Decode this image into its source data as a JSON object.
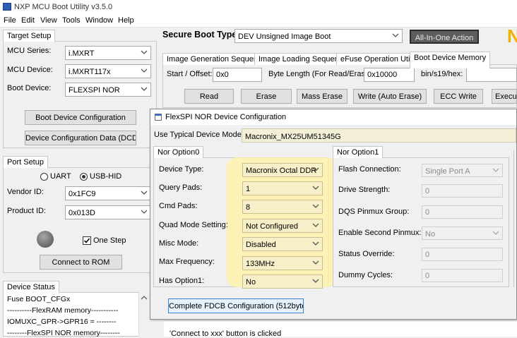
{
  "window": {
    "title": "NXP MCU Boot Utility v3.5.0"
  },
  "menu": [
    "File",
    "Edit",
    "View",
    "Tools",
    "Window",
    "Help"
  ],
  "target_setup": {
    "tab": "Target Setup",
    "mcu_series_label": "MCU Series:",
    "mcu_series": "i.MXRT",
    "mcu_device_label": "MCU Device:",
    "mcu_device": "i.MXRT117x",
    "boot_device_label": "Boot Device:",
    "boot_device": "FLEXSPI NOR",
    "boot_device_config_button": "Boot Device Configuration",
    "dcd_button": "Device Configuration Data (DCD)"
  },
  "port_setup": {
    "tab": "Port Setup",
    "uart_label": "UART",
    "usbhid_label": "USB-HID",
    "vendor_id_label": "Vendor ID:",
    "vendor_id": "0x1FC9",
    "product_id_label": "Product ID:",
    "product_id": "0x013D",
    "one_step_label": "One Step",
    "connect_button": "Connect to ROM"
  },
  "device_status": {
    "tab": "Device Status",
    "lines": [
      "Fuse BOOT_CFGx",
      "----------FlexRAM memory-----------",
      "IOMUXC_GPR->GPR16 = --------",
      "--------FlexSPI NOR memory--------"
    ]
  },
  "secure_boot": {
    "label": "Secure Boot Type",
    "value": "DEV Unsigned Image Boot",
    "all_in_one_button": "All-In-One Action",
    "logo_fragment": "N"
  },
  "main_tabs": [
    "Image Generation Sequence",
    "Image Loading Sequence",
    "eFuse Operation Utility",
    "Boot Device Memory"
  ],
  "boot_memory": {
    "start_offset_label": "Start / Offset:",
    "start_offset": "0x0",
    "byte_length_label": "Byte Length (For Read/Erase):",
    "byte_length": "0x10000",
    "bin_label": "bin/s19/hex:",
    "bin_value": "",
    "buttons": [
      "Read",
      "Erase",
      "Mass Erase",
      "Write (Auto Erase)",
      "ECC Write",
      "Execute"
    ]
  },
  "log": {
    "line": "'Connect to xxx' button is clicked"
  },
  "dialog": {
    "title": "FlexSPI NOR Device Configuration",
    "typical_label": "Use Typical Device Model:",
    "typical_value": "Macronix_MX25UM51345G",
    "opt0": {
      "tab": "Nor Option0",
      "rows": [
        {
          "label": "Device Type:",
          "value": "Macronix Octal DDR"
        },
        {
          "label": "Query Pads:",
          "value": "1"
        },
        {
          "label": "Cmd Pads:",
          "value": "8"
        },
        {
          "label": "Quad Mode Setting:",
          "value": "Not Configured"
        },
        {
          "label": "Misc Mode:",
          "value": "Disabled"
        },
        {
          "label": "Max Frequency:",
          "value": "133MHz"
        },
        {
          "label": "Has Option1:",
          "value": "No"
        }
      ]
    },
    "opt1": {
      "tab": "Nor Option1",
      "rows": [
        {
          "label": "Flash Connection:",
          "value": "Single Port A"
        },
        {
          "label": "Drive Strength:",
          "value": "0"
        },
        {
          "label": "DQS Pinmux Group:",
          "value": "0"
        },
        {
          "label": "Enable Second Pinmux:",
          "value": "No"
        },
        {
          "label": "Status Override:",
          "value": "0"
        },
        {
          "label": "Dummy Cycles:",
          "value": "0"
        }
      ]
    },
    "complete_button": "Complete FDCB Configuration (512bytes)"
  },
  "colors": {
    "highlight": "#fff3a6",
    "accent_logo": "#f2b000"
  }
}
